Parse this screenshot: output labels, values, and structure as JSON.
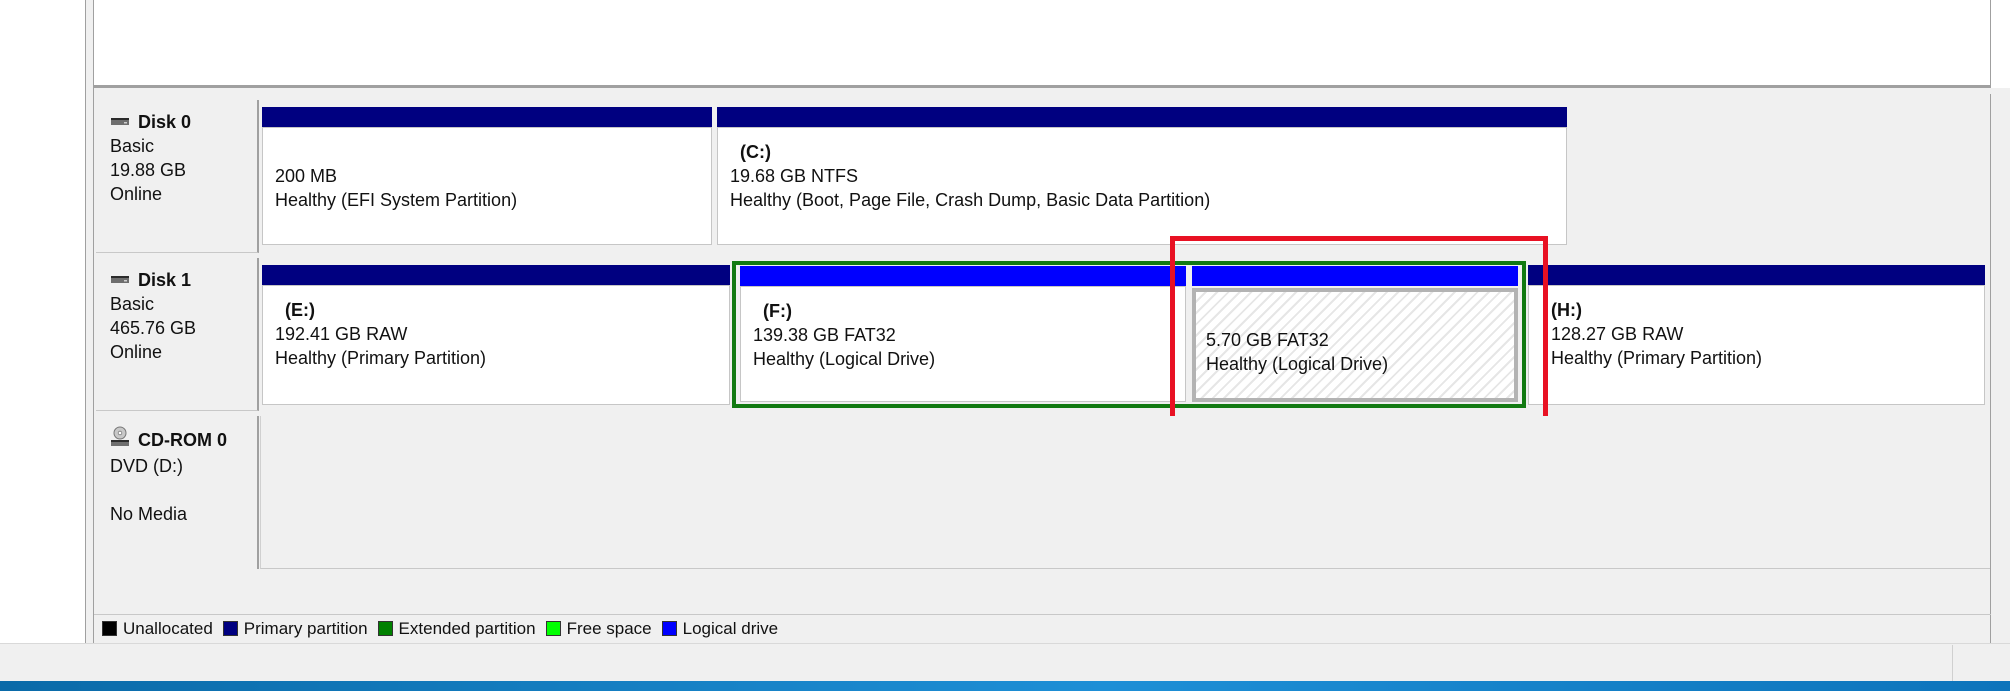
{
  "disks": [
    {
      "name": "Disk 0",
      "type": "Basic",
      "size": "19.88 GB",
      "status": "Online",
      "icon": "hard-disk-icon",
      "partitions": [
        {
          "letter": "",
          "size": "200 MB",
          "status": "Healthy (EFI System Partition)",
          "kind": "primary"
        },
        {
          "letter": "(C:)",
          "size": "19.68 GB NTFS",
          "status": "Healthy (Boot, Page File, Crash Dump, Basic Data Partition)",
          "kind": "primary"
        }
      ]
    },
    {
      "name": "Disk 1",
      "type": "Basic",
      "size": "465.76 GB",
      "status": "Online",
      "icon": "hard-disk-icon",
      "partitions": [
        {
          "letter": "(E:)",
          "size": "192.41 GB RAW",
          "status": "Healthy (Primary Partition)",
          "kind": "primary"
        },
        {
          "letter": "(F:)",
          "size": "139.38 GB FAT32",
          "status": "Healthy (Logical Drive)",
          "kind": "logical"
        },
        {
          "letter": "",
          "size": "5.70 GB FAT32",
          "status": "Healthy (Logical Drive)",
          "kind": "logical",
          "selected": true
        },
        {
          "letter": "(H:)",
          "size": "128.27 GB RAW",
          "status": "Healthy (Primary Partition)",
          "kind": "primary"
        }
      ]
    },
    {
      "name": "CD-ROM 0",
      "type": "DVD (D:)",
      "size": "",
      "status": "No Media",
      "icon": "cd-rom-icon"
    }
  ],
  "legend": [
    {
      "label": "Unallocated",
      "color": "#000000"
    },
    {
      "label": "Primary partition",
      "color": "#000080"
    },
    {
      "label": "Extended partition",
      "color": "#008000"
    },
    {
      "label": "Free space",
      "color": "#00ff00"
    },
    {
      "label": "Logical drive",
      "color": "#0000ff"
    }
  ],
  "colors": {
    "primary_bar": "#000080",
    "logical_bar": "#0000ff",
    "extended_border": "#127a12",
    "highlight": "#e81123"
  }
}
